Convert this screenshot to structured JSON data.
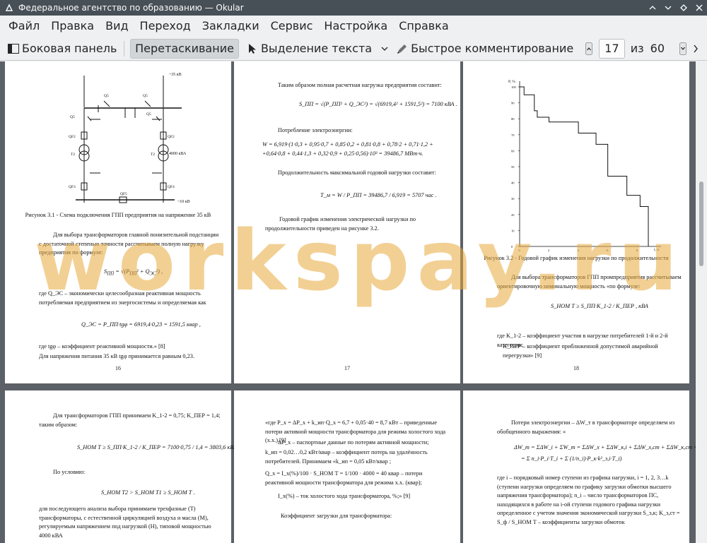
{
  "window": {
    "title": "Федеральное агентство по образованию  — Okular"
  },
  "menu": [
    "Файл",
    "Правка",
    "Вид",
    "Переход",
    "Закладки",
    "Сервис",
    "Настройка",
    "Справка"
  ],
  "toolbar": {
    "sidebar_label": "Боковая панель",
    "drag_label": "Перетаскивание",
    "text_select_label": "Выделение текста",
    "quick_comment_label": "Быстрое комментирование",
    "current_page": "17",
    "of_label": "из",
    "total_pages": "60"
  },
  "pages": {
    "p16": {
      "caption": "Рисунок 3.1 - Схема подключения ГПП предприятия на напряжение 35 кВ",
      "para1": "Для выбора трансформаторов главной понизительной подстанции с достаточной степенью точности рассчитываем полную нагрузку предприятия по формуле:",
      "para2": "где Q_ЭС – экономически целесообразная реактивная мощность потребляемая предприятием из энергосистемы и определяемая как",
      "formula1": "Q_ЭС = P_ПП·tgφ = 6919,4·0,23 = 1591,5 квар ,",
      "para3": "где tgφ – коэффициент реактивной мощности.» [8]",
      "para4": "Для напряжения питания 35 кВ tgφ принимается равным 0,23.",
      "num": "16",
      "labels": {
        "kv35": "~35 кВ",
        "kv10": "~10 кВ",
        "kva": "4000 кВА",
        "q5a": "Q5",
        "q5b": "Q5",
        "q5c": "Q5",
        "q5d": "Q5",
        "qf2a": "QF2",
        "qf2b": "QF2",
        "t2a": "T2",
        "t2b": "T2",
        "qf3": "QF3",
        "qf4": "QF4",
        "qf5": "QF5"
      }
    },
    "p17": {
      "para1": "Таким образом полная расчетная нагрузка предприятия составит:",
      "formula1": "S_ПП = √(P_ПП² + Q_ЭС²) = √(6919,4² + 1591,5²) = 7100 кВА .",
      "para2": "Потребление электроэнергии:",
      "formula2": "W = 6,919·(1·0,3 + 0,95·0,7 + 0,85·0,2 + 0,81·0,8 + 0,78·2 + 0,71·1,2 +",
      "formula3": "+0,64·0,8 + 0,44·1,3 + 0,32·0,9 + 0,25·0,56)·10³ = 39486,7 МВт·ч.",
      "para3": "Продолжительность максимальной годовой нагрузки составит:",
      "formula4": "T_м = W / P_ПП = 39486,7 / 6,919 = 5707 час .",
      "para4": "Годовой график изменения электрической нагрузки по продолжительности приведен на рисунке 3.2.",
      "num": "17"
    },
    "p18": {
      "caption": "Рисунок 3.2 - Годовой график изменения нагрузки по продолжительности",
      "para1": "Для выбора трансформаторов ГПП промпредприятия рассчитываем ориентировочную номинальную мощность «по формуле:",
      "formula1": "S_НОМ Т ≥ S_ПП·K_1-2 / K_ПЕР , кВА",
      "para2": "где K_1-2 – коэффициент участия в нагрузке потребителей 1-й и 2-й категории;",
      "para3": "K_ПЕР – коэффициент приближенной допустимой аварийной перегрузки» [9]",
      "num": "18",
      "axis_y": "P, %",
      "axis_x": "t, ч"
    },
    "p19": {
      "para1": "Для трансформаторов ГПП принимаем K_1-2 = 0,75; K_ПЕР = 1,4; таким образом:",
      "formula1": "S_НОМ Т ≥ S_ПП·K_1-2 / K_ПЕР = 7100·0,75 / 1,4 = 3803,6 кВА",
      "para2": "По условию:",
      "formula2": "S_НОМ Т2 > S_НОМ Т1 ≥ S_НОМ Т .",
      "para3": "для последующего анализа выбора принимаем трехфазные (Т) трансформаторы, с естественной циркуляцией воздуха и масла (М), регулируемым напряжением под нагрузкой (Н), типовой мощностью 4000 кВА"
    },
    "p20": {
      "para1": "«где P_x = ΔP_x + k_ип·Q_x = 6,7 + 0,05·40 = 8,7 кВт – приведенные потери активной мощности трансформатора для режима холостого хода (х.х.).[9]",
      "para2": "ΔP_x – паспортные данные по потерям активной мощности;",
      "para3": "k_ип = 0,02…0,2 кВт/квар – коэффициент потерь на удалённость потребителей. Принимаем «k_ип = 0,05 кВт/квар ;",
      "formula1": "Q_x = I_x(%)/100 · S_НОМ Т = 1/100 · 4000 = 40 квар – потери реактивной мощности трансформатора для режима х.х. (квар);",
      "para4": "I_x(%) – ток холостого хода трансформатора, %;» [9]",
      "para5": "Коэффициент загрузки для трансформатора:"
    },
    "p21": {
      "para1": "Потери электроэнергии – ΔW_т в трансформаторе определяем из обобщенного выражения: «",
      "formula1": "ΔW_т = ΣΔW_i + ΣW_т = ΣΔW_x + ΣΔW_к,i + ΣΔW_x,ст + ΣΔW_к,ст =",
      "formula2": "= Σ n_i·P_i·T_i + Σ (1/n_i)·P_к·k²_з,i·T_i)",
      "para2": "где i – порядковый номер ступени из графика нагрузки, i = 1, 2, 3…k (ступени нагрузки определяем по графику загрузки обмотки высшего напряжения трансформатора); n_i – число трансформаторов ПС, находящихся в работе на i-ой ступени годового графика нагрузки определенное с учетом значения экономической нагрузки S_э,к; K_з,ст = S_ф / S_НОМ Т – коэффициенты загрузки обмоток"
    }
  },
  "watermark": "workspay.ru",
  "chart_data": {
    "type": "line",
    "title": "",
    "xlabel": "t, ч",
    "ylabel": "P, %",
    "series": [
      {
        "values": [
          100,
          95,
          85,
          81,
          78,
          71,
          64,
          44,
          32,
          25,
          0
        ]
      }
    ],
    "x": [
      0,
      300,
      1000,
      1200,
      2000,
      4000,
      5200,
      6000,
      7300,
      8200,
      8760
    ],
    "ylim": [
      0,
      100
    ]
  }
}
